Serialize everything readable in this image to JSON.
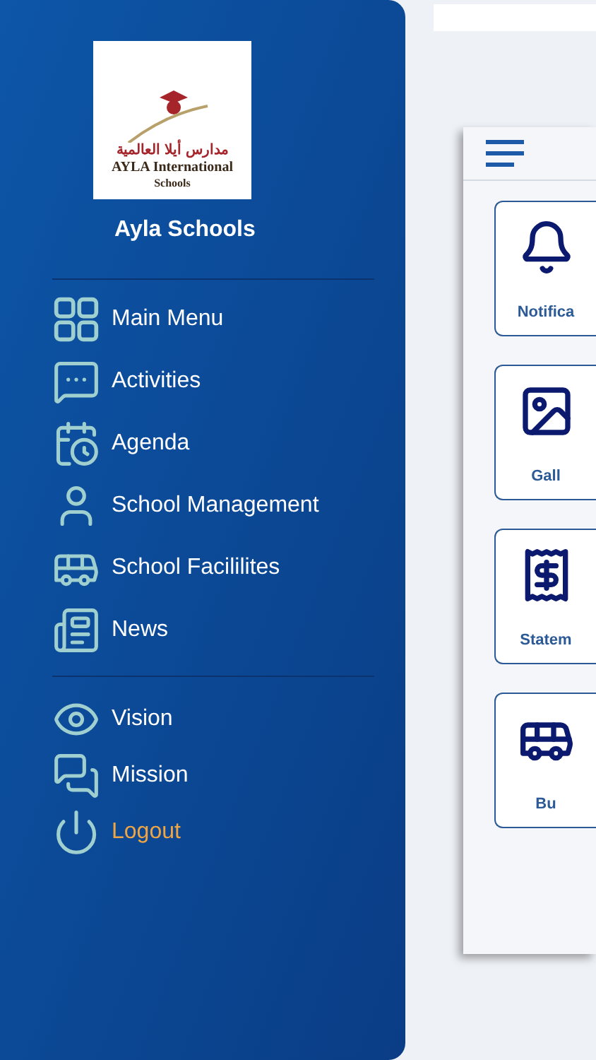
{
  "sidebar": {
    "logo": {
      "arabic": "مدارس أيلا العالمية",
      "english": "AYLA International",
      "subtitle": "Schools"
    },
    "title": "Ayla Schools",
    "sections": [
      [
        {
          "label": "Main Menu",
          "kind": "link"
        },
        {
          "label": "Activities",
          "kind": "link"
        },
        {
          "label": "Agenda",
          "kind": "link"
        },
        {
          "label": "School Management",
          "kind": "link"
        },
        {
          "label": "School Facililites",
          "kind": "link"
        },
        {
          "label": "News",
          "kind": "link"
        }
      ],
      [
        {
          "label": "Vision",
          "kind": "link"
        },
        {
          "label": "Mission",
          "kind": "link"
        },
        {
          "label": "Logout",
          "kind": "logout"
        }
      ]
    ]
  },
  "main": {
    "tiles": [
      {
        "label": "Notifica"
      },
      {
        "label": "Gall"
      },
      {
        "label": "Statem"
      },
      {
        "label": "Bu"
      }
    ]
  }
}
